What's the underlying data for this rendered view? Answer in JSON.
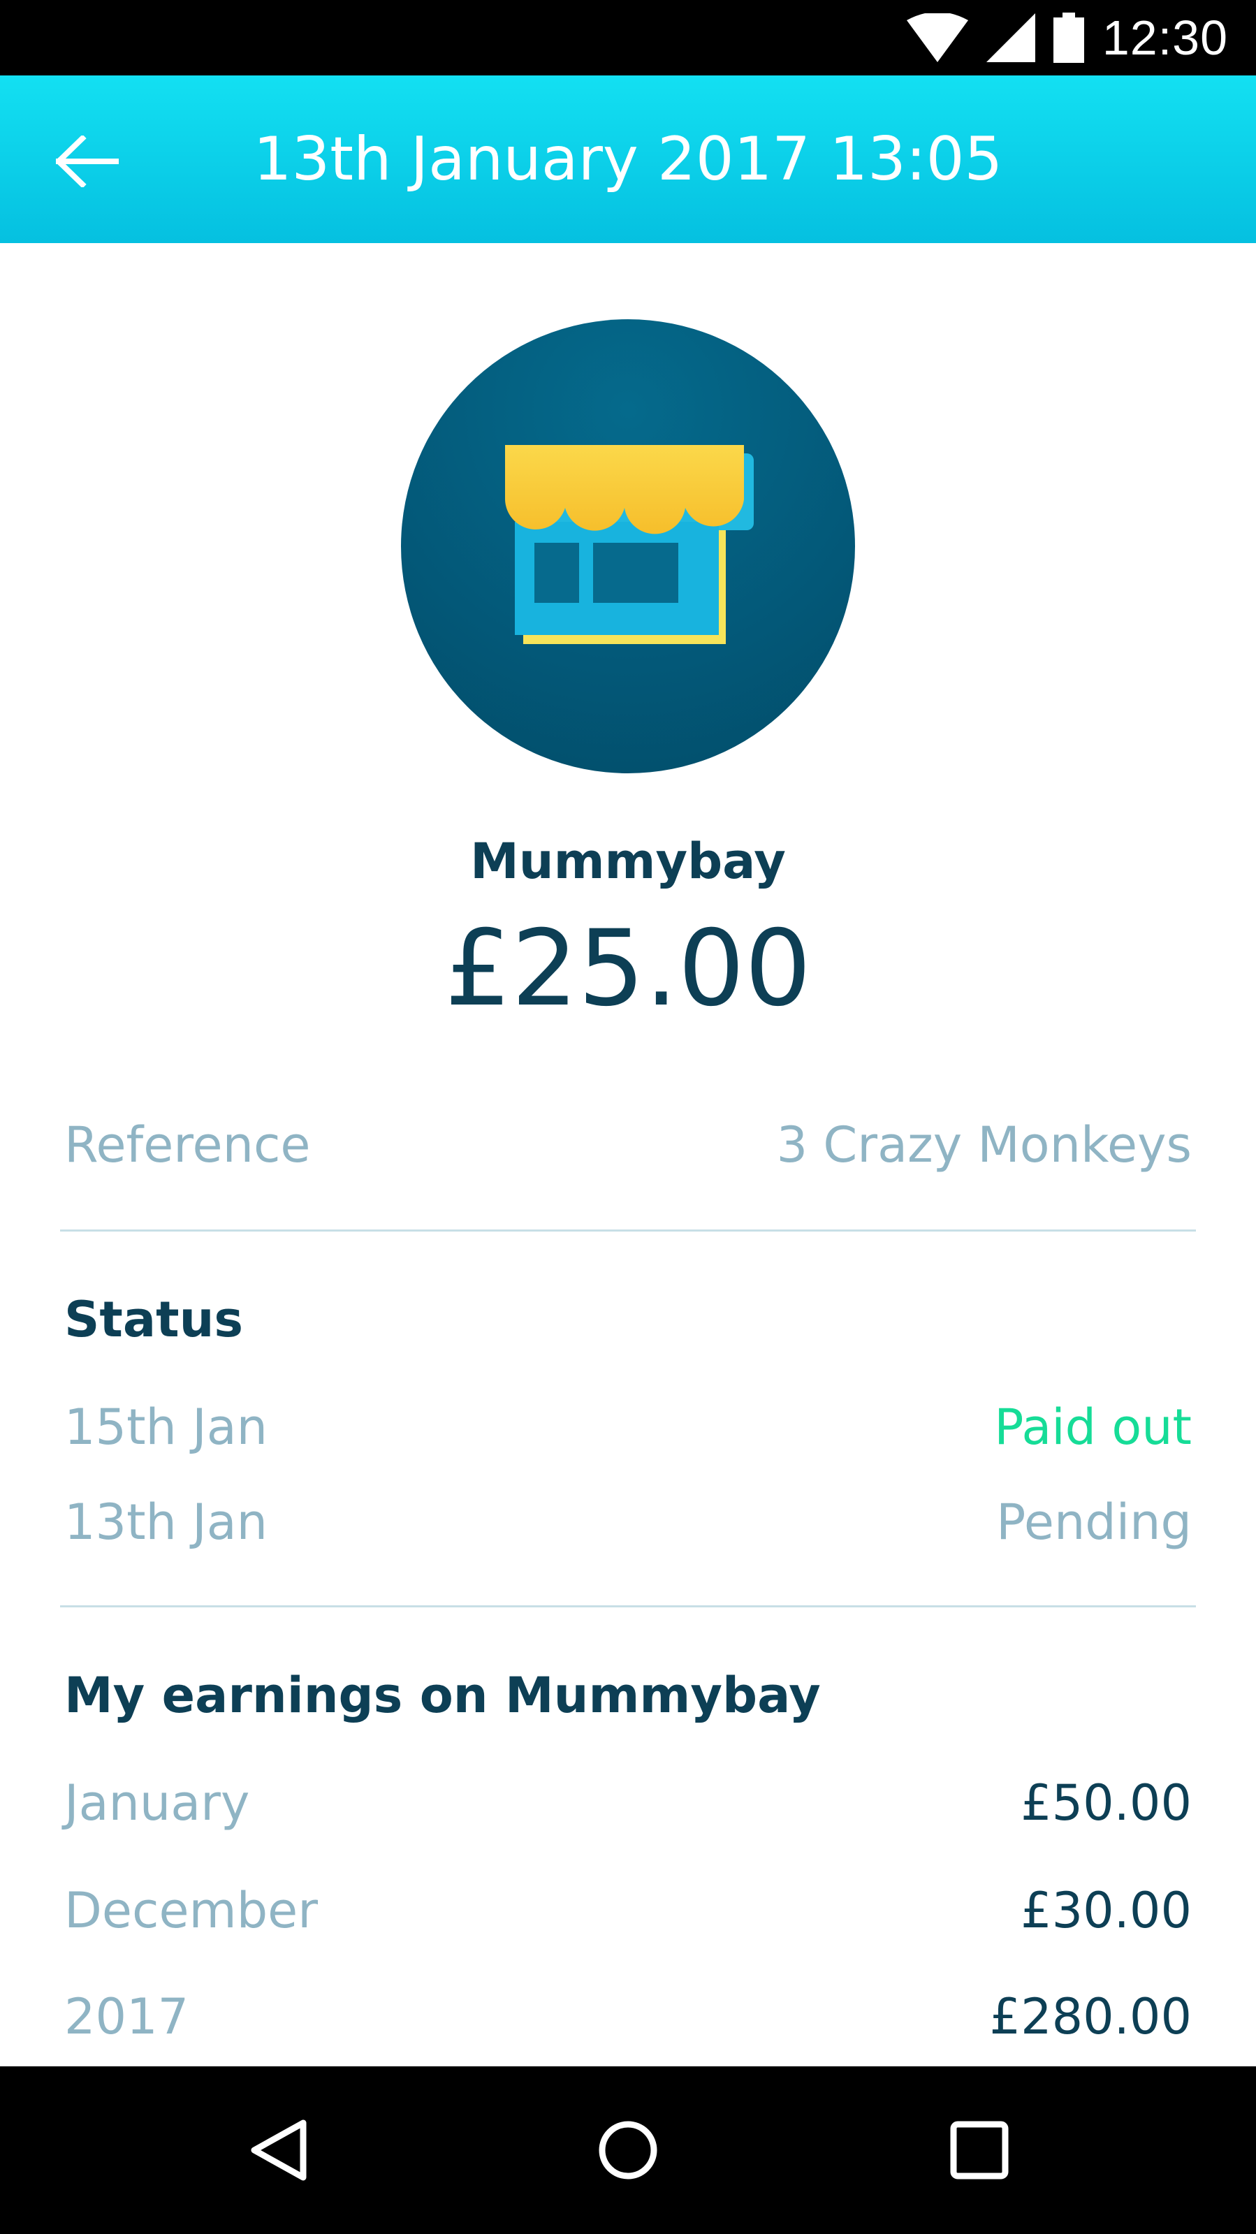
{
  "status_bar": {
    "time": "12:30"
  },
  "app_bar": {
    "title": "13th January 2017 13:05"
  },
  "merchant": {
    "name": "Mummybay",
    "amount": "£25.00",
    "icon": "shop-icon"
  },
  "reference": {
    "label": "Reference",
    "value": "3 Crazy Monkeys"
  },
  "status": {
    "heading": "Status",
    "entries": [
      {
        "date": "15th Jan",
        "state": "Paid out"
      },
      {
        "date": "13th Jan",
        "state": "Pending"
      }
    ]
  },
  "earnings": {
    "heading": "My earnings on Mummybay",
    "rows": [
      {
        "period": "January",
        "amount": "£50.00"
      },
      {
        "period": "December",
        "amount": "£30.00"
      },
      {
        "period": "2017",
        "amount": "£280.00"
      }
    ]
  },
  "colors": {
    "app_bar": "#0ccfe9",
    "primary_text": "#0d3f55",
    "secondary_text": "#8fb4c4",
    "paid_out": "#16dc97",
    "avatar_bg": "#035878"
  }
}
